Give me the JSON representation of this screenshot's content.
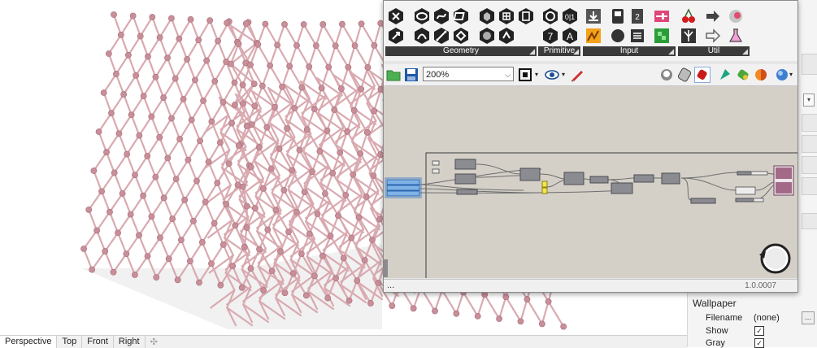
{
  "viewport": {
    "tabs": [
      "Perspective",
      "Top",
      "Front",
      "Right"
    ],
    "active_tab": "Perspective",
    "add_tab_icon": "plus-icon",
    "truss_color": "#d9aab0",
    "node_color": "#c98f99"
  },
  "grasshopper": {
    "groups": [
      {
        "name": "Geometry",
        "label": "Geometry"
      },
      {
        "name": "Primitive",
        "label": "Primitive"
      },
      {
        "name": "Input",
        "label": "Input"
      },
      {
        "name": "Util",
        "label": "Util"
      }
    ],
    "zoom_value": "200%",
    "status_left": "...",
    "version": "1.0.0007"
  },
  "properties": {
    "section_title": "Wallpaper",
    "rows": [
      {
        "label": "Filename",
        "value": "(none)"
      },
      {
        "label": "Show",
        "value": "✓"
      },
      {
        "label": "Gray",
        "value": "✓"
      }
    ]
  }
}
